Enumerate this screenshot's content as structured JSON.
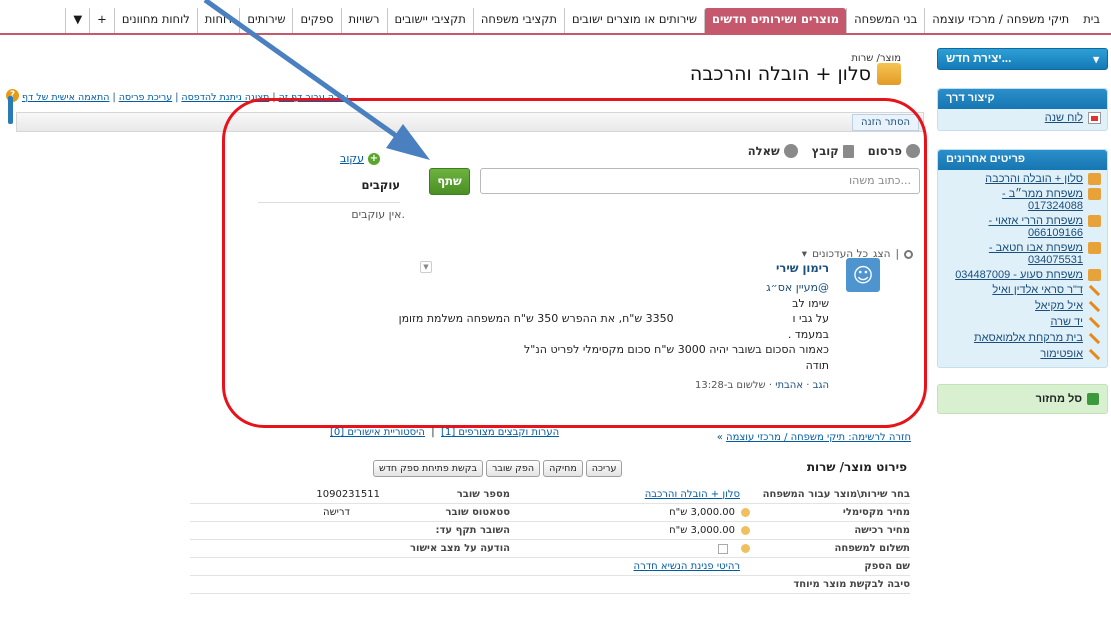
{
  "tabs": [
    "בית",
    "תיקי משפחה / מרכזי עוצמה",
    "בני המשפחה",
    "מוצרים ושירותים חדשים",
    "שירותים או מוצרים ישובים",
    "תקציבי משפחה",
    "תקציבי יישובים",
    "רשויות",
    "ספקים",
    "שירותים",
    "דוחות",
    "לוחות מחוונים",
    "+",
    "▼"
  ],
  "active_tab_index": 3,
  "accent_color": "#c5586d",
  "sidebar": {
    "create_new": "יצירת חדש...",
    "shortcut_title": "קיצור דרך",
    "calendar_link": "לוח שנה",
    "recent_title": "פריטים אחרונים",
    "recent_items": [
      {
        "label": "סלון + הובלה והרכבה",
        "icon": "product-box-icon"
      },
      {
        "label": "משפחת ממר״ב - 017324088",
        "icon": "family-icon"
      },
      {
        "label": "משפחת הררי אזאוי - 066109166",
        "icon": "family-icon"
      },
      {
        "label": "משפחת אבו חטאב - 034075531",
        "icon": "family-icon"
      },
      {
        "label": "משפחת סעוע - 034487009",
        "icon": "family-icon"
      },
      {
        "label": "ד\"ר סראי אלדין ואיל",
        "icon": "pencil-icon"
      },
      {
        "label": "איל מקיאל",
        "icon": "pencil-icon"
      },
      {
        "label": "יד שרה",
        "icon": "pencil-icon"
      },
      {
        "label": "בית מרקחת אלמואסאת",
        "icon": "pencil-icon"
      },
      {
        "label": "אופטימור",
        "icon": "pencil-icon"
      }
    ],
    "recycle": "סל מחזור"
  },
  "header": {
    "breadcrumb": "מוצר/ שרות",
    "title": "סלון + הובלה והרכבה",
    "page_links": [
      "התאמה אישית של דף",
      "עריכת פריסה",
      "תצוגה ניתנת להדפסה",
      "עזרה עבור דף זה"
    ],
    "hide_feed": "הסתר הזנה"
  },
  "feed": {
    "tabs": [
      "פרסום",
      "קובץ",
      "שאלה"
    ],
    "compose_placeholder": "כתוב משהו...",
    "share": "שתף",
    "follow": "עקוב",
    "followers_title": "עוקבים",
    "no_followers": "אין עוקבים.",
    "filter_show": "הצג",
    "filter_value": "כל העדכונים",
    "post": {
      "author": "רימון שירי",
      "mention": "@מעיין אס״ג",
      "lines": [
        "שימו לב",
        "על גבי ו                                  3350 ש\"ח, את ההפרש 350 ש\"ח המשפחה משלמת מזומן",
        "במעמד .",
        "כאמור הסכום בשובר יהיה 3000 ש\"ח סכום מקסימלי לפריט הנ\"ל",
        "תודה"
      ],
      "actions": [
        "הגב",
        "אהבתי",
        "שלשום ב-13:28"
      ]
    }
  },
  "back_link": "חזרה לרשימה: תיקי משפחה / מרכזי עוצמה",
  "comments_links": [
    "הערות וקבצים מצורפים [1]",
    "היסטוריית אישורים [0]"
  ],
  "details": {
    "title": "פירוט מוצר/ שרות",
    "buttons": [
      "עריכה",
      "מחיקה",
      "הפק שובר",
      "בקשת פתיחת ספק חדש"
    ],
    "rows": [
      {
        "label": "בחר שירות\\מוצר עבור המשפחה",
        "value": "סלון + הובלה והרכבה",
        "label2": "מספר שובר",
        "value2": "1090231511"
      },
      {
        "label": "מחיר מקסימלי",
        "value": "3,000.00 ש\"ח",
        "label2": "סטאטוס שובר",
        "value2": "דרישה"
      },
      {
        "label": "מחיר רכישה",
        "value": "3,000.00 ש\"ח",
        "label2": "השובר תקף עד:",
        "value2": ""
      },
      {
        "label": "תשלום למשפחה",
        "value": "",
        "label2": "הודעה על מצב אישור",
        "value2": ""
      },
      {
        "label": "שם הספק",
        "value": "רהיטי פנינת הנשיא חדרה",
        "label2": "",
        "value2": ""
      },
      {
        "label": "סיבה לבקשת מוצר מיוחד",
        "value": "",
        "label2": "",
        "value2": ""
      }
    ]
  }
}
